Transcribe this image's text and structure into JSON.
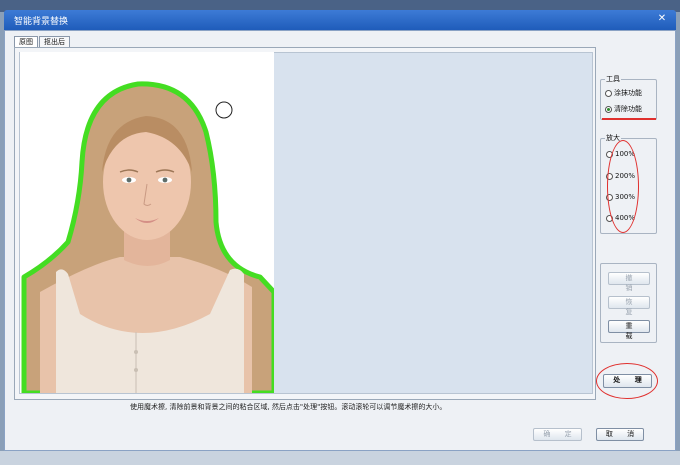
{
  "window": {
    "title": "智能背景替换"
  },
  "tabs": [
    {
      "label": "原图"
    },
    {
      "label": "抠出后"
    }
  ],
  "tools": {
    "legend": "工具",
    "options": [
      {
        "label": "涂抹功能",
        "selected": false
      },
      {
        "label": "清除功能",
        "selected": true
      }
    ]
  },
  "zoom": {
    "legend": "放大",
    "options": [
      {
        "label": "100%"
      },
      {
        "label": "200%"
      },
      {
        "label": "300%"
      },
      {
        "label": "400%"
      }
    ]
  },
  "actions": {
    "undo_label": "撤 销",
    "redo_label": "恢 复",
    "reset_label": "重 载",
    "process_label": "处 理"
  },
  "hint_text": "使用魔术擦, 清除前景和背景之间的粘合区域, 然后点击\"处理\"按钮。滚动滚轮可以调节魔术擦的大小。",
  "footer": {
    "ok_label": "确 定",
    "cancel_label": "取 消"
  },
  "colors": {
    "annotation": "#e0302e",
    "outline": "#44dd22",
    "titlebar": "#2a6acb"
  }
}
